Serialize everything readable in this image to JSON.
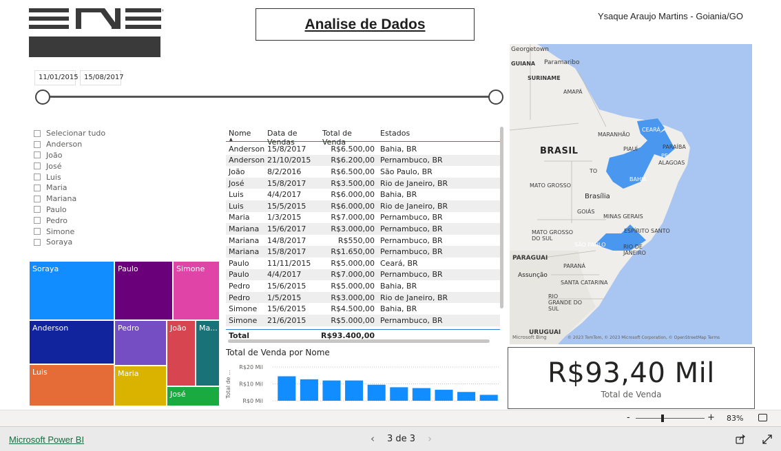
{
  "header": {
    "title": "Analise de Dados",
    "author": "Ysaque Araujo Martins - Goiania/GO"
  },
  "date_slicer": {
    "start": "11/01/2015",
    "end": "15/08/2017"
  },
  "name_filter": {
    "items": [
      "Selecionar tudo",
      "Anderson",
      "João",
      "José",
      "Luis",
      "Maria",
      "Mariana",
      "Paulo",
      "Pedro",
      "Simone",
      "Soraya"
    ]
  },
  "treemap": {
    "labels": [
      "Soraya",
      "Paulo",
      "Simone",
      "Anderson",
      "Pedro",
      "João",
      "Ma...",
      "Luis",
      "Maria",
      "José"
    ],
    "colors": [
      "#118dff",
      "#6b007b",
      "#e044a7",
      "#12239e",
      "#744ec2",
      "#d64550",
      "#197278",
      "#e66c37",
      "#d9b300",
      "#1aab40"
    ]
  },
  "table": {
    "headers": [
      "Nome",
      "Data de Vendas",
      "Total de Venda",
      "Estados"
    ],
    "rows": [
      [
        "Anderson",
        "15/8/2017",
        "R$6.500,00",
        "Bahia, BR"
      ],
      [
        "Anderson",
        "21/10/2015",
        "R$6.200,00",
        "Pernambuco, BR"
      ],
      [
        "João",
        "8/2/2016",
        "R$6.500,00",
        "São Paulo, BR"
      ],
      [
        "José",
        "15/8/2017",
        "R$3.500,00",
        "Rio de Janeiro, BR"
      ],
      [
        "Luis",
        "4/4/2017",
        "R$6.000,00",
        "Bahia, BR"
      ],
      [
        "Luis",
        "15/5/2015",
        "R$6.000,00",
        "Rio de Janeiro, BR"
      ],
      [
        "Maria",
        "1/3/2015",
        "R$7.000,00",
        "Pernambuco, BR"
      ],
      [
        "Mariana",
        "15/6/2017",
        "R$3.000,00",
        "Pernambuco, BR"
      ],
      [
        "Mariana",
        "14/8/2017",
        "R$550,00",
        "Pernambuco, BR"
      ],
      [
        "Mariana",
        "15/8/2017",
        "R$1.650,00",
        "Pernambuco, BR"
      ],
      [
        "Paulo",
        "11/11/2015",
        "R$5.000,00",
        "Ceará, BR"
      ],
      [
        "Paulo",
        "4/4/2017",
        "R$7.000,00",
        "Pernambuco, BR"
      ],
      [
        "Pedro",
        "15/6/2015",
        "R$5.000,00",
        "Bahia, BR"
      ],
      [
        "Pedro",
        "1/5/2015",
        "R$3.000,00",
        "Rio de Janeiro, BR"
      ],
      [
        "Simone",
        "15/6/2015",
        "R$4.500,00",
        "Bahia, BR"
      ],
      [
        "Simone",
        "21/6/2015",
        "R$5.000,00",
        "Pernambuco, BR"
      ]
    ],
    "total_label": "Total",
    "total_value": "R$93.400,00"
  },
  "chart_title": "Total de Venda por Nome",
  "chart_data": {
    "type": "bar",
    "title": "Total de Venda por Nome",
    "ylabel": "Total de ...",
    "xlabel": "",
    "yticks": [
      "R$0 Mil",
      "R$10 Mil",
      "R$20 Mil"
    ],
    "ylim": [
      0,
      20000
    ],
    "values": [
      14500,
      12700,
      12000,
      12000,
      9500,
      8000,
      7500,
      6500,
      5200,
      3500
    ],
    "color": "#118dff"
  },
  "map": {
    "labels": {
      "georgetown": "Georgetown",
      "guiana": "GUIANA",
      "paramaribo": "Paramaribo",
      "suriname": "SURINAME",
      "amapa": "AMAPÁ",
      "brasil": "BRASIL",
      "maranhao": "MARANHÃO",
      "ceara": "CEARÁ",
      "paraiba": "PARAÍBA",
      "piaui": "PIAUÍ",
      "pe": "PE",
      "alagoas": "ALAGOAS",
      "to": "TO",
      "bahia": "BAHIA",
      "mato_grosso": "MATO GROSSO",
      "brasilia": "Brasília",
      "goias": "GOIÁS",
      "minas": "MINAS GERAIS",
      "ms": "MATO GROSSO DO SUL",
      "es": "ESPÍRITO SANTO",
      "sp": "SÃO PAULO",
      "rj": "RIO DE JANEIRO",
      "paraguai": "PARAGUAI",
      "parana": "PARANÁ",
      "assuncao": "Assunção",
      "sc": "SANTA CATARINA",
      "rs": "RIO GRANDE DO SUL",
      "uruguai": "URUGUAI"
    },
    "brand": "Microsoft Bing",
    "credit": "© 2023 TomTom, © 2023 Microsoft Corporation, © OpenStreetMap  Terms"
  },
  "kpi": {
    "value": "R$93,40 Mil",
    "label": "Total de Venda"
  },
  "zoom": {
    "minus": "-",
    "plus": "+",
    "level": "83%"
  },
  "footer": {
    "link": "Microsoft Power BI",
    "page": "3 de 3",
    "prev": "‹",
    "next": "›"
  }
}
